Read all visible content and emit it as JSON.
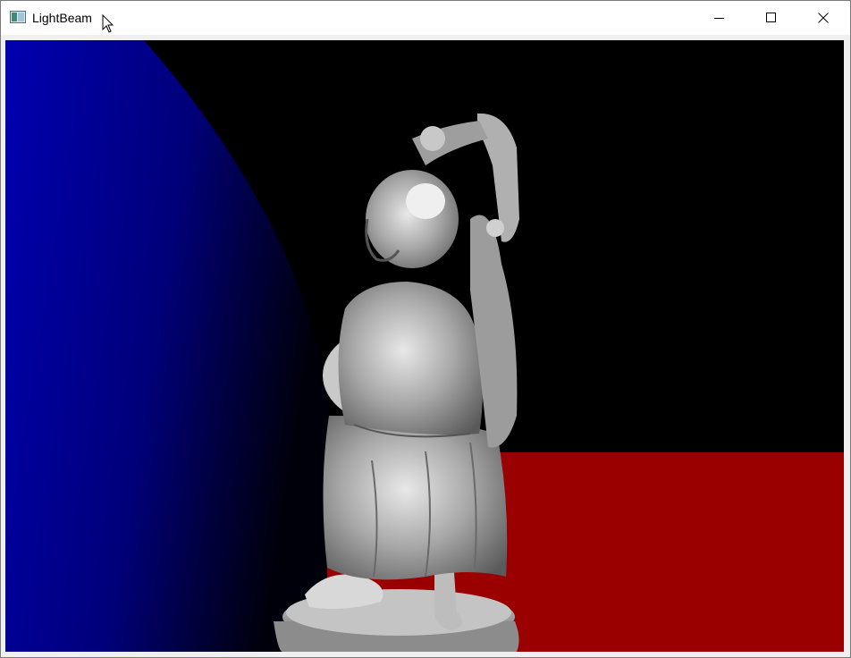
{
  "window": {
    "title": "LightBeam",
    "app_icon": "window-app-icon",
    "controls": {
      "minimize": "minimize-icon",
      "maximize": "maximize-icon",
      "close": "close-icon"
    }
  },
  "scene": {
    "background_color": "#000000",
    "floor_color": "#9a0000",
    "sphere_color": "#0000a8",
    "statue_color": "#b8b8b8"
  }
}
